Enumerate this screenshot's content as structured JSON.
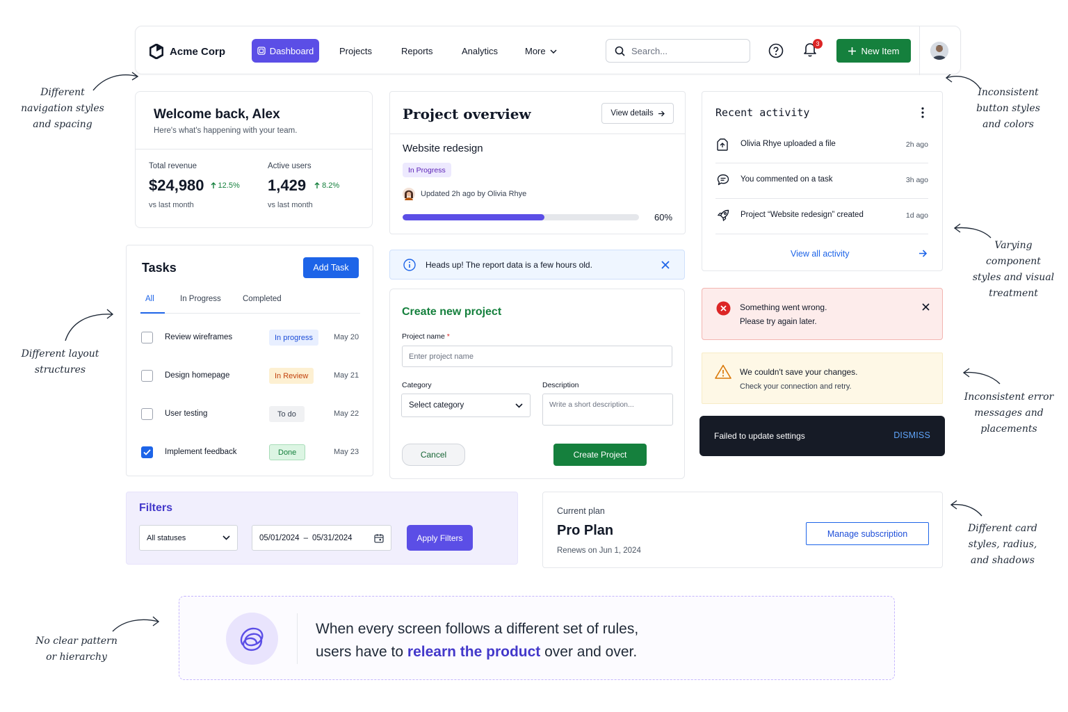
{
  "nav": {
    "brand": "Acme Corp",
    "dashboard": "Dashboard",
    "links": [
      "Projects",
      "Reports",
      "Analytics"
    ],
    "more": "More",
    "search_placeholder": "Search...",
    "notification_count": "3",
    "new_item": "New Item"
  },
  "welcome": {
    "title": "Welcome back, Alex",
    "subtitle": "Here's what's happening with your team.",
    "metrics": [
      {
        "label": "Total revenue",
        "value": "$24,980",
        "delta": "12.5%",
        "sub": "vs last month"
      },
      {
        "label": "Active users",
        "value": "1,429",
        "delta": "8.2%",
        "sub": "vs last month"
      }
    ]
  },
  "tasks": {
    "title": "Tasks",
    "add_task": "Add Task",
    "tabs": [
      "All",
      "In Progress",
      "Completed"
    ],
    "rows": [
      {
        "name": "Review wireframes",
        "status": "In progress",
        "date": "May 20",
        "checked": false
      },
      {
        "name": "Design homepage",
        "status": "In Review",
        "date": "May 21",
        "checked": false
      },
      {
        "name": "User testing",
        "status": "To do",
        "date": "May 22",
        "checked": false
      },
      {
        "name": "Implement feedback",
        "status": "Done",
        "date": "May 23",
        "checked": true
      }
    ]
  },
  "overview": {
    "title": "Project overview",
    "view_details": "View details",
    "project": "Website redesign",
    "status": "In Progress",
    "updated": "Updated 2h ago by Olivia Rhye",
    "progress": 60,
    "progress_label": "60%"
  },
  "info_alert": {
    "text": "Heads up! The report data is a few hours old."
  },
  "create_project": {
    "title": "Create new project",
    "name_label": "Project name",
    "required_mark": "*",
    "name_placeholder": "Enter project name",
    "category_label": "Category",
    "category_value": "Select category",
    "description_label": "Description",
    "description_placeholder": "Write a short description...",
    "cancel": "Cancel",
    "submit": "Create Project"
  },
  "activity": {
    "title": "Recent activity",
    "items": [
      {
        "text": "Olivia Rhye uploaded a file",
        "time": "2h ago"
      },
      {
        "text": "You commented on a task",
        "time": "3h ago"
      },
      {
        "text": "Project “Website redesign” created",
        "time": "1d ago"
      }
    ],
    "view_all": "View all activity"
  },
  "error_alert": {
    "title": "Something went wrong.",
    "subtitle": "Please try again later."
  },
  "warning_alert": {
    "title": "We couldn't save your changes.",
    "subtitle": "Check your connection and retry."
  },
  "toast": {
    "text": "Failed to update settings",
    "action": "DISMISS"
  },
  "filters": {
    "title": "Filters",
    "status_value": "All statuses",
    "date_start": "05/01/2024",
    "date_sep": "–",
    "date_end": "05/31/2024",
    "apply": "Apply Filters"
  },
  "plan": {
    "label": "Current plan",
    "name": "Pro Plan",
    "renews": "Renews on Jun 1, 2024",
    "manage": "Manage subscription"
  },
  "banner": {
    "line1": "When every screen follows a different set of rules,",
    "line2_pre": "users have to ",
    "line2_accent": "relearn the product",
    "line2_post": " over and over."
  },
  "annotations": {
    "nav": [
      "Different",
      "navigation styles",
      "and spacing"
    ],
    "buttons": [
      "Inconsistent",
      "button styles",
      "and colors"
    ],
    "layout": [
      "Different layout",
      "structures"
    ],
    "components": [
      "Varying component",
      "styles and visual",
      "treatment"
    ],
    "errors": [
      "Inconsistent error",
      "messages and",
      "placements"
    ],
    "cards": [
      "Different card",
      "styles, radius,",
      "and shadows"
    ],
    "pattern": [
      "No clear pattern",
      "or hierarchy"
    ]
  },
  "colors": {
    "primary_purple": "#5b4ee6",
    "primary_blue": "#1d64e8",
    "success_green": "#15803d",
    "error_red": "#dc2626",
    "warning_amber": "#d97706",
    "toast_dark": "#161b26"
  },
  "icons": [
    "logo-icon",
    "dashboard-icon",
    "chevron-down-icon",
    "search-icon",
    "help-icon",
    "bell-icon",
    "plus-icon",
    "arrow-right-icon",
    "info-icon",
    "close-icon",
    "file-icon",
    "comment-icon",
    "rocket-icon",
    "kebab-icon",
    "error-icon",
    "warning-icon",
    "calendar-icon",
    "check-icon"
  ]
}
